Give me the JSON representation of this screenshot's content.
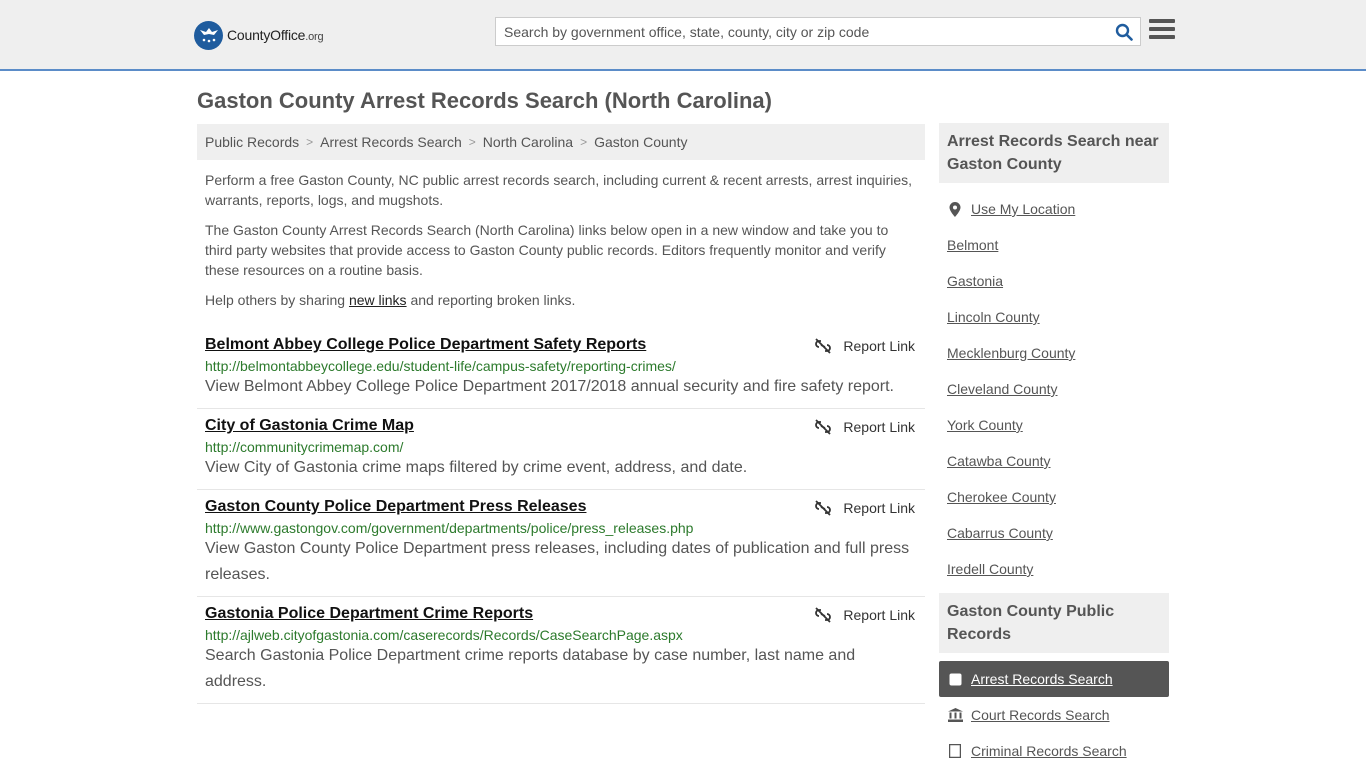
{
  "header": {
    "logo_text": "CountyOffice",
    "logo_org": ".org",
    "search_placeholder": "Search by government office, state, county, city or zip code"
  },
  "page_title": "Gaston County Arrest Records Search (North Carolina)",
  "breadcrumb": [
    "Public Records",
    "Arrest Records Search",
    "North Carolina",
    "Gaston County"
  ],
  "intro": {
    "p1": "Perform a free Gaston County, NC public arrest records search, including current & recent arrests, arrest inquiries, warrants, reports, logs, and mugshots.",
    "p2": "The Gaston County Arrest Records Search (North Carolina) links below open in a new window and take you to third party websites that provide access to Gaston County public records. Editors frequently monitor and verify these resources on a routine basis.",
    "p3_before": "Help others by sharing ",
    "p3_link": "new links",
    "p3_after": " and reporting broken links."
  },
  "report_label": "Report Link",
  "results": [
    {
      "title": "Belmont Abbey College Police Department Safety Reports",
      "url": "http://belmontabbeycollege.edu/student-life/campus-safety/reporting-crimes/",
      "desc": "View Belmont Abbey College Police Department 2017/2018 annual security and fire safety report."
    },
    {
      "title": "City of Gastonia Crime Map",
      "url": "http://communitycrimemap.com/",
      "desc": "View City of Gastonia crime maps filtered by crime event, address, and date."
    },
    {
      "title": "Gaston County Police Department Press Releases",
      "url": "http://www.gastongov.com/government/departments/police/press_releases.php",
      "desc": "View Gaston County Police Department press releases, including dates of publication and full press releases."
    },
    {
      "title": "Gastonia Police Department Crime Reports",
      "url": "http://ajlweb.cityofgastonia.com/caserecords/Records/CaseSearchPage.aspx",
      "desc": "Search Gastonia Police Department crime reports database by case number, last name and address."
    }
  ],
  "sidebar": {
    "near_heading": "Arrest Records Search near Gaston County",
    "use_location": "Use My Location",
    "near_links": [
      "Belmont",
      "Gastonia",
      "Lincoln County",
      "Mecklenburg County",
      "Cleveland County",
      "York County",
      "Catawba County",
      "Cherokee County",
      "Cabarrus County",
      "Iredell County"
    ],
    "public_heading": "Gaston County Public Records",
    "public_links": [
      "Arrest Records Search",
      "Court Records Search",
      "Criminal Records Search"
    ]
  }
}
